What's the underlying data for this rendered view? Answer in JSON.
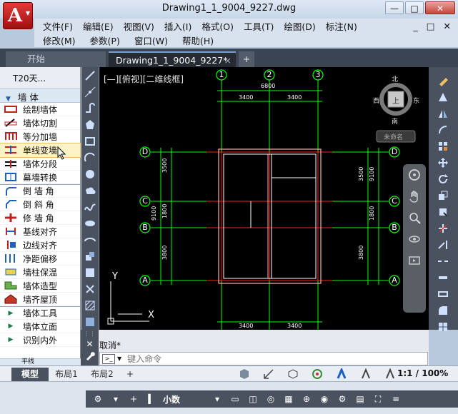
{
  "window": {
    "title": "Drawing1_1_9004_9227.dwg",
    "controls": [
      "—",
      "□",
      "✕"
    ]
  },
  "menu": {
    "row1": [
      "文件(F)",
      "编辑(E)",
      "视图(V)",
      "插入(I)",
      "格式(O)",
      "工具(T)",
      "绘图(D)",
      "标注(N)"
    ],
    "row2": [
      "修改(M)",
      "参数(P)",
      "窗口(W)",
      "帮助(H)"
    ],
    "mdi_controls": [
      "_",
      "□",
      "✕"
    ]
  },
  "tabs": {
    "start": "开始",
    "drawing": "Drawing1_1_9004_9227*",
    "close": "×",
    "plus": "+"
  },
  "left_panel": {
    "header": "T20天...",
    "section": "墙  体",
    "items": [
      "绘制墙体",
      "墙体切割",
      "等分加墙",
      "单线变墙",
      "墙体分段",
      "幕墙转换",
      "倒 墙 角",
      "倒 斜 角",
      "修 墙 角",
      "基线对齐",
      "边线对齐",
      "净距偏移",
      "墙柱保温",
      "墙体造型",
      "墙齐屋顶"
    ],
    "expandable": [
      "墙体工具",
      "墙体立面",
      "识别内外"
    ],
    "footer": "平线"
  },
  "canvas": {
    "view_label": "[—][俯视][二维线框]",
    "axis_top": [
      "1",
      "2",
      "3"
    ],
    "axis_side": [
      "D",
      "C",
      "B",
      "A"
    ],
    "dim_top_total": "6800",
    "dim_top": [
      "3400",
      "3400"
    ],
    "dim_bottom": [
      "3400",
      "3400"
    ],
    "dim_left": [
      "3500",
      "1800",
      "3800"
    ],
    "dim_left_total": "9100",
    "dim_right": [
      "3500",
      "1800",
      "3800"
    ],
    "dim_right_total": "9100",
    "compass": {
      "n": "北",
      "s": "南",
      "e": "东",
      "w": "西",
      "top": "上"
    },
    "ucs_label": "未命名",
    "ucs_axes": {
      "x": "X",
      "y": "Y"
    },
    "colors": {
      "grid": "#00ff00",
      "axis": "#ff2020",
      "wall": "#ffffff",
      "wall_edge": "#ffb0b0",
      "dim_text": "#ffffff"
    }
  },
  "command": {
    "history": "取消*",
    "placeholder": "键入命令",
    "side_icons": [
      "✕",
      "🔧"
    ]
  },
  "layout_tabs": [
    "模型",
    "布局1",
    "布局2",
    "+"
  ],
  "status": {
    "scale": "1:1 / 100%",
    "unit": "小数"
  }
}
